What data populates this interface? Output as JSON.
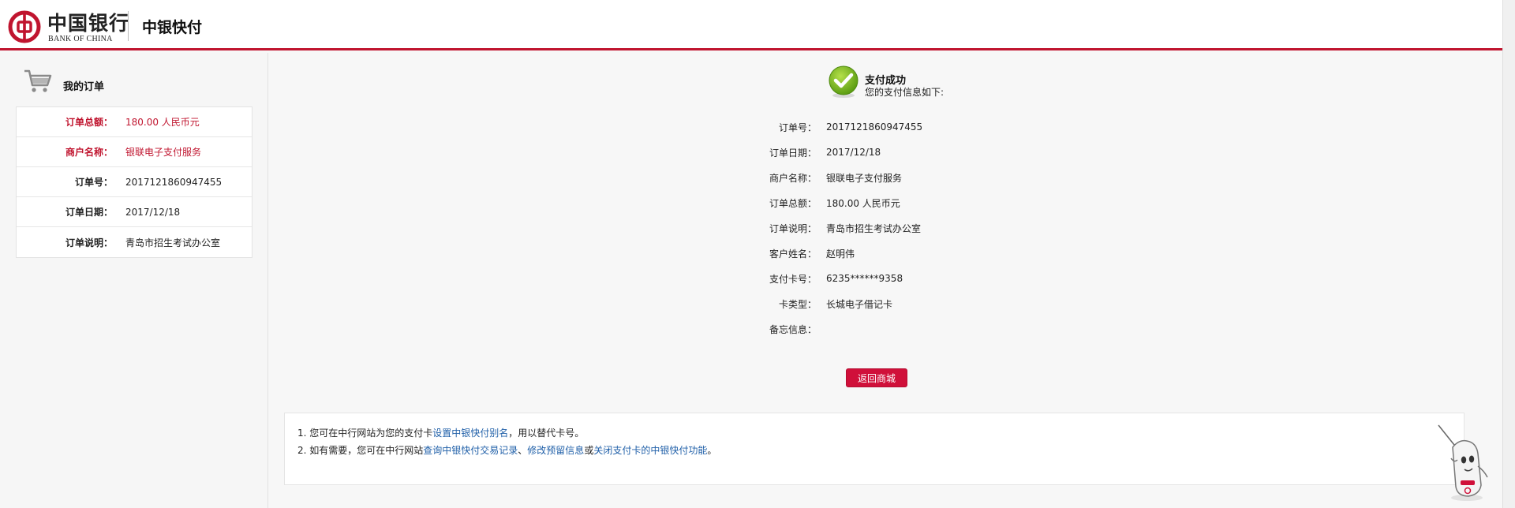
{
  "header": {
    "logo_cn": "中国银行",
    "logo_en": "BANK OF CHINA",
    "brand": "中银快付",
    "accent_color": "#c0152f"
  },
  "sidebar": {
    "title": "我的订单",
    "icon": "shopping-cart-icon",
    "rows": [
      {
        "label": "订单总额：",
        "value": "180.00 人民币元",
        "highlight": true
      },
      {
        "label": "商户名称：",
        "value": "银联电子支付服务",
        "highlight": true
      },
      {
        "label": "订单号：",
        "value": "2017121860947455",
        "highlight": false
      },
      {
        "label": "订单日期：",
        "value": "2017/12/18",
        "highlight": false
      },
      {
        "label": "订单说明：",
        "value": "青岛市招生考试办公室",
        "highlight": false
      }
    ]
  },
  "main": {
    "success_icon": "checkmark-icon",
    "success_title": "支付成功",
    "success_sub": "您的支付信息如下:",
    "info": [
      {
        "label": "订单号：",
        "value": "2017121860947455"
      },
      {
        "label": "订单日期：",
        "value": "2017/12/18"
      },
      {
        "label": "商户名称：",
        "value": "银联电子支付服务"
      },
      {
        "label": "订单总额：",
        "value": "180.00 人民币元"
      },
      {
        "label": "订单说明：",
        "value": "青岛市招生考试办公室"
      },
      {
        "label": "客户姓名：",
        "value": "赵明伟"
      },
      {
        "label": "支付卡号：",
        "value": "6235******9358"
      },
      {
        "label": "卡类型：",
        "value": "长城电子借记卡"
      },
      {
        "label": "备忘信息：",
        "value": ""
      }
    ],
    "back_button": "返回商城"
  },
  "notice": {
    "line1_prefix": "1. 您可在中行网站为您的支付卡",
    "line1_link": "设置中银快付别名",
    "line1_suffix": "，用以替代卡号。",
    "line2_prefix": "2. 如有需要，您可在中行网站",
    "line2_link1": "查询中银快付交易记录",
    "line2_sep": "、",
    "line2_link2": "修改预留信息",
    "line2_or": "或",
    "line2_link3": "关闭支付卡的中银快付功能",
    "line2_end": "。"
  }
}
